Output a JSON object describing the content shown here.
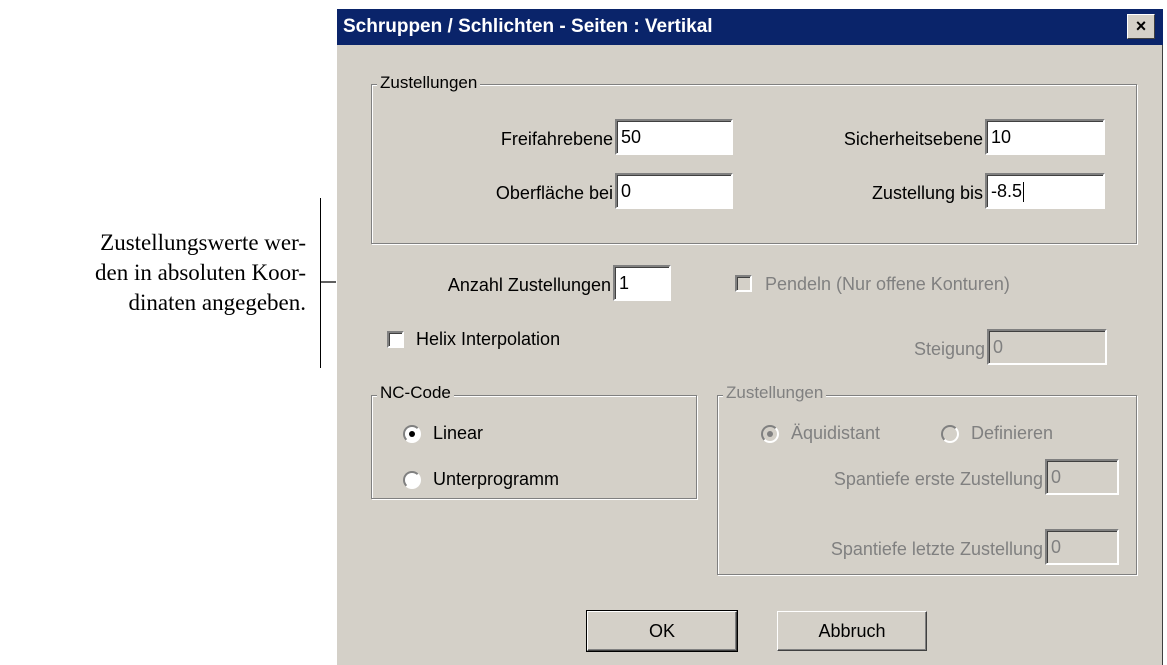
{
  "annotation": {
    "lines": [
      "Zustellungswerte wer-",
      "den in absoluten Koor-",
      "dinaten angegeben."
    ]
  },
  "dialog": {
    "title": "Schruppen / Schlichten - Seiten : Vertikal",
    "close_label": "×",
    "group_zustellungen": {
      "label": "Zustellungen",
      "freifahrebene": {
        "label": "Freifahrebene",
        "value": "50"
      },
      "sicherheitsebene": {
        "label": "Sicherheitsebene",
        "value": "10"
      },
      "oberflaeche": {
        "label": "Oberfläche bei",
        "value": "0"
      },
      "zustellung_bis": {
        "label": "Zustellung bis",
        "value": "-8.5"
      }
    },
    "anzahl_zustellungen": {
      "label": "Anzahl Zustellungen",
      "value": "1"
    },
    "pendeln": {
      "label": "Pendeln (Nur offene Konturen)",
      "checked": false,
      "enabled": false
    },
    "helix": {
      "label": "Helix Interpolation",
      "checked": false
    },
    "steigung": {
      "label": "Steigung",
      "value": "0",
      "enabled": false
    },
    "nc_code": {
      "label": "NC-Code",
      "linear": {
        "label": "Linear",
        "selected": true
      },
      "unterprogramm": {
        "label": "Unterprogramm",
        "selected": false
      }
    },
    "group_zustellungen2": {
      "label": "Zustellungen",
      "aequidistant": {
        "label": "Äquidistant",
        "selected": true,
        "enabled": false
      },
      "definieren": {
        "label": "Definieren",
        "selected": false,
        "enabled": false
      },
      "spantiefe_erste": {
        "label": "Spantiefe erste Zustellung",
        "value": "0"
      },
      "spantiefe_letzte": {
        "label": "Spantiefe letzte Zustellung",
        "value": "0"
      }
    },
    "ok_label": "OK",
    "cancel_label": "Abbruch"
  },
  "colors": {
    "titlebar": "#0a246a",
    "dialog_bg": "#d4d0c8",
    "disabled_text": "#808080"
  }
}
